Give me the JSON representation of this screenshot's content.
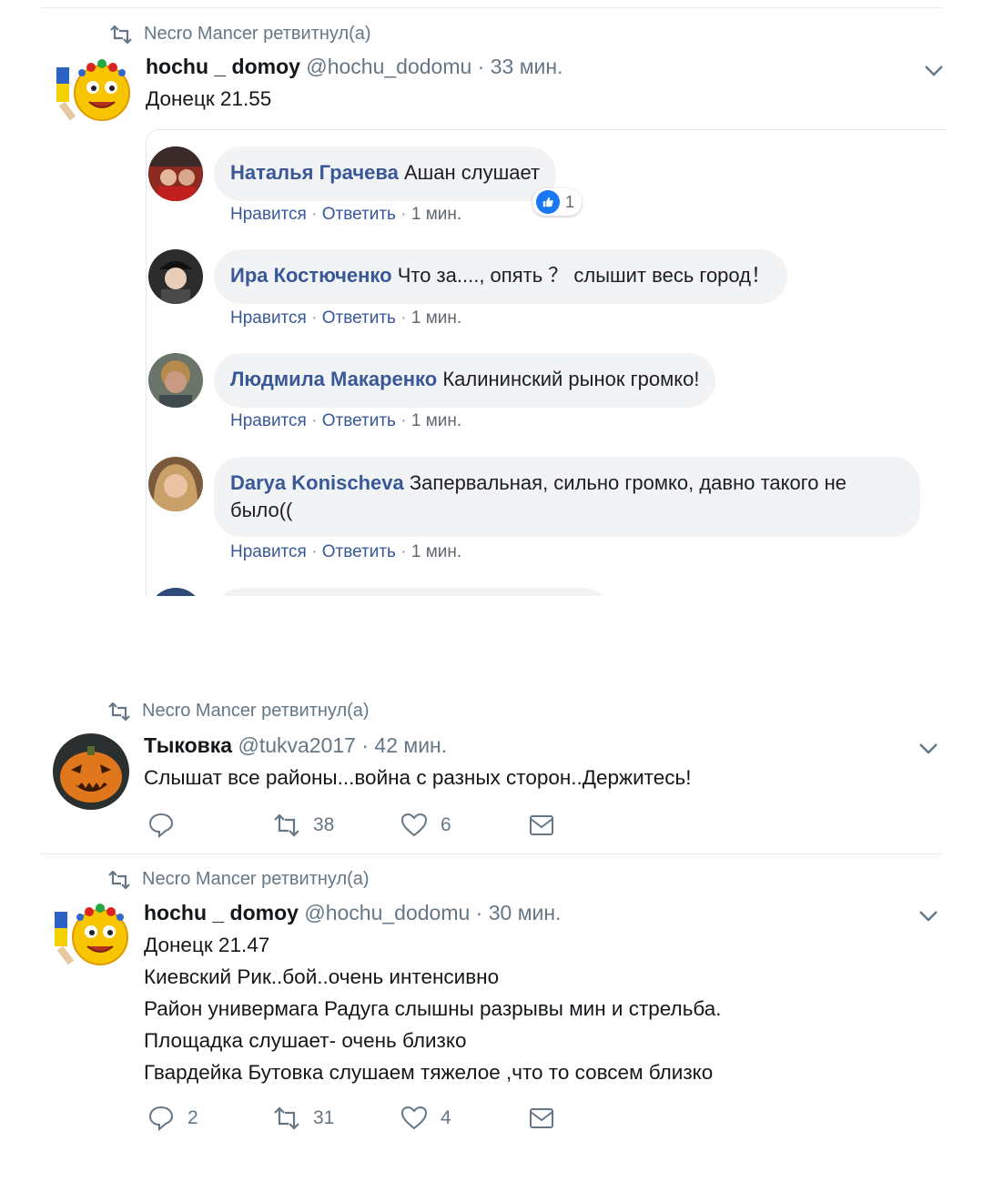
{
  "tweets": [
    {
      "retweet_label": "Necro Mancer ретвитнул(а)",
      "name": "hochu _ domoy",
      "handle": "@hochu_dodomu",
      "time": "· 33 мин.",
      "lines": [
        "Донецк 21.55"
      ],
      "embed": {
        "comments": [
          {
            "author": "Наталья Грачева",
            "text": "Ашан слушает",
            "like": "Нравится",
            "reply": "Ответить",
            "time": "1 мин.",
            "reactions": "1"
          },
          {
            "author": "Ира Костюченко",
            "text": "Что за...., опять ？ слышит весь город！",
            "like": "Нравится",
            "reply": "Ответить",
            "time": "1 мин."
          },
          {
            "author": "Людмила Макаренко",
            "text": "Калининский рынок громко!",
            "like": "Нравится",
            "reply": "Ответить",
            "time": "1 мин."
          },
          {
            "author": "Darya Konischeva",
            "text": "Запервальная, сильно громко, давно такого не было((",
            "like": "Нравится",
            "reply": "Ответить",
            "time": "1 мин."
          }
        ]
      }
    },
    {
      "retweet_label": "Necro Mancer ретвитнул(а)",
      "name": "Тыковка",
      "handle": "@tukva2017",
      "time": "· 42 мин.",
      "lines": [
        "Слышат все районы...война с разных сторон..Держитесь!"
      ],
      "actions": {
        "reply": "",
        "retweets": "38",
        "likes": "6"
      }
    },
    {
      "retweet_label": "Necro Mancer ретвитнул(а)",
      "name": "hochu _ domoy",
      "handle": "@hochu_dodomu",
      "time": "· 30 мин.",
      "lines": [
        "Донецк 21.47",
        "Киевский Рик..бой..очень интенсивно",
        "Район универмага Радуга слышны разрывы мин и стрельба.",
        "Площадка слушает- очень близко",
        "Гвардейка Бутовка слушаем тяжелое ,что то совсем близко"
      ],
      "actions": {
        "reply": "2",
        "retweets": "31",
        "likes": "4"
      }
    }
  ],
  "icons": [
    "retweet-icon",
    "chevron-down-icon",
    "reply-icon",
    "heart-icon",
    "message-icon",
    "like-reaction-icon"
  ],
  "colors": {
    "name_link": "#385898",
    "secondary": "#657786",
    "bubble": "#f2f3f5",
    "like_blue": "#1877f2"
  }
}
